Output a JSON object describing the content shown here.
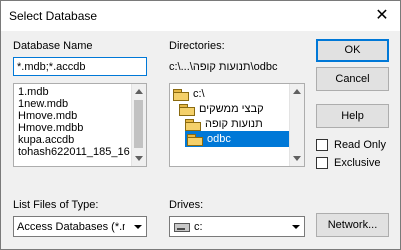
{
  "dialog": {
    "title": "Select Database",
    "close_glyph": "✕"
  },
  "database_name": {
    "label": "Database Name",
    "value": "*.mdb;*.accdb",
    "files": [
      "1.mdb",
      "1new.mdb",
      "Hmove.mdb",
      "Hmove.mdbb",
      "kupa.accdb",
      "tohash622011_185_16"
    ]
  },
  "directories": {
    "label": "Directories:",
    "path": "c:\\...\\תנועות קופה\\odbc",
    "items": [
      "c:\\",
      "קבצי ממשקים",
      "תנועות קופה",
      "odbc"
    ],
    "selected": "odbc"
  },
  "buttons": {
    "ok": "OK",
    "cancel": "Cancel",
    "help": "Help",
    "network": "Network..."
  },
  "options": {
    "read_only": "Read Only",
    "exclusive": "Exclusive"
  },
  "file_type": {
    "label": "List Files of Type:",
    "value": "Access Databases (*.mdb;*.accdb)"
  },
  "drives": {
    "label": "Drives:",
    "value": "c:"
  },
  "icons": [
    "close-icon",
    "folder-icon",
    "open-folder-icon",
    "drive-icon",
    "dropdown-arrow-icon",
    "scroll-up-icon",
    "scroll-down-icon"
  ],
  "colors": {
    "accent": "#0078d7",
    "background": "#f0f0f0"
  }
}
